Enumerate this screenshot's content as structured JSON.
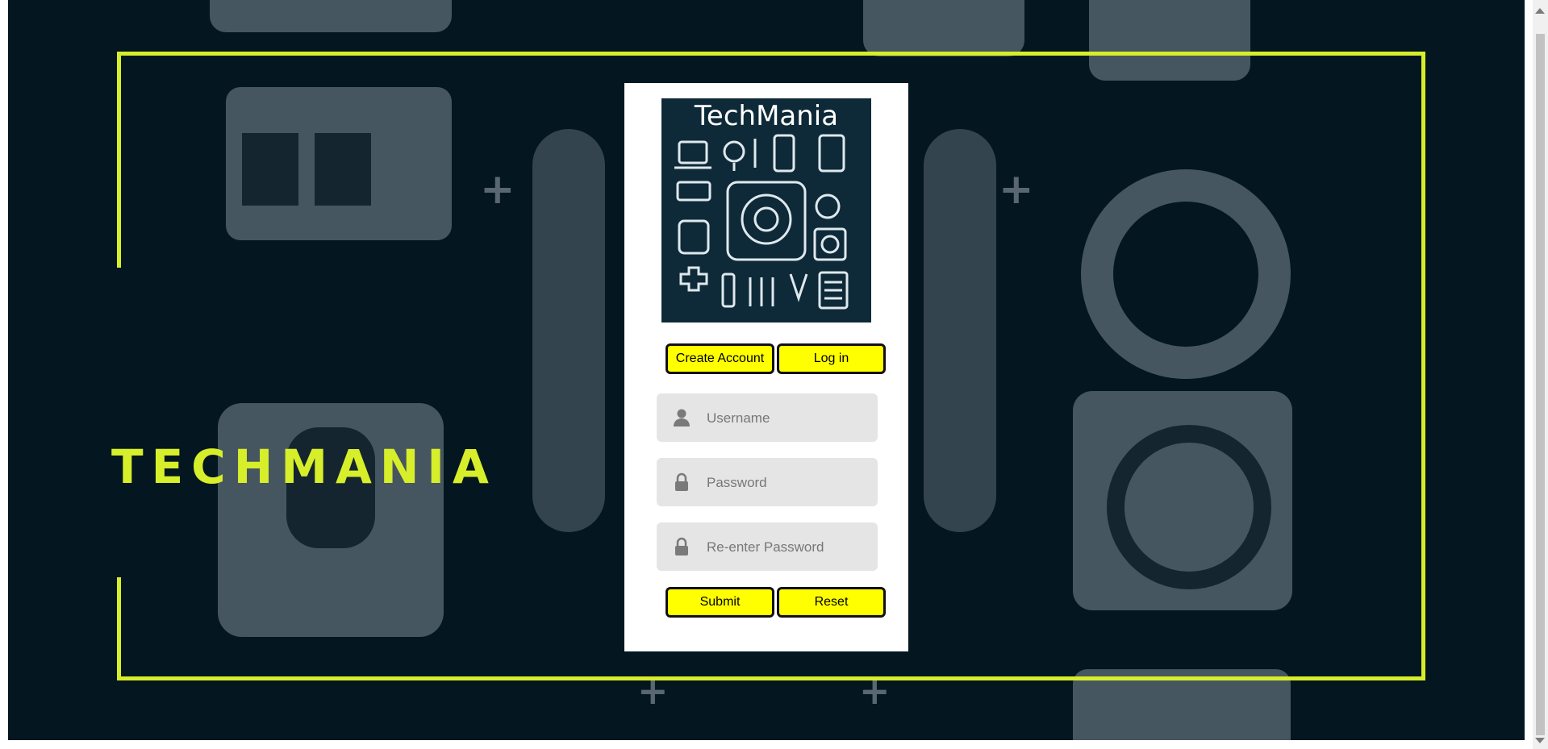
{
  "brand": {
    "text": "TECHMANIA",
    "accent": "#d7ee2a"
  },
  "logo": {
    "title": "TechMania",
    "background": "#0e2a38"
  },
  "tabs": {
    "create_account": "Create Account",
    "log_in": "Log in"
  },
  "form": {
    "username_placeholder": "Username",
    "password_placeholder": "Password",
    "reenter_placeholder": "Re-enter Password",
    "username_icon": "user-icon",
    "password_icon": "lock-icon"
  },
  "actions": {
    "submit": "Submit",
    "reset": "Reset"
  },
  "colors": {
    "button_bg": "#ffff00",
    "page_bg": "#041620",
    "field_bg": "#e5e5e5"
  }
}
